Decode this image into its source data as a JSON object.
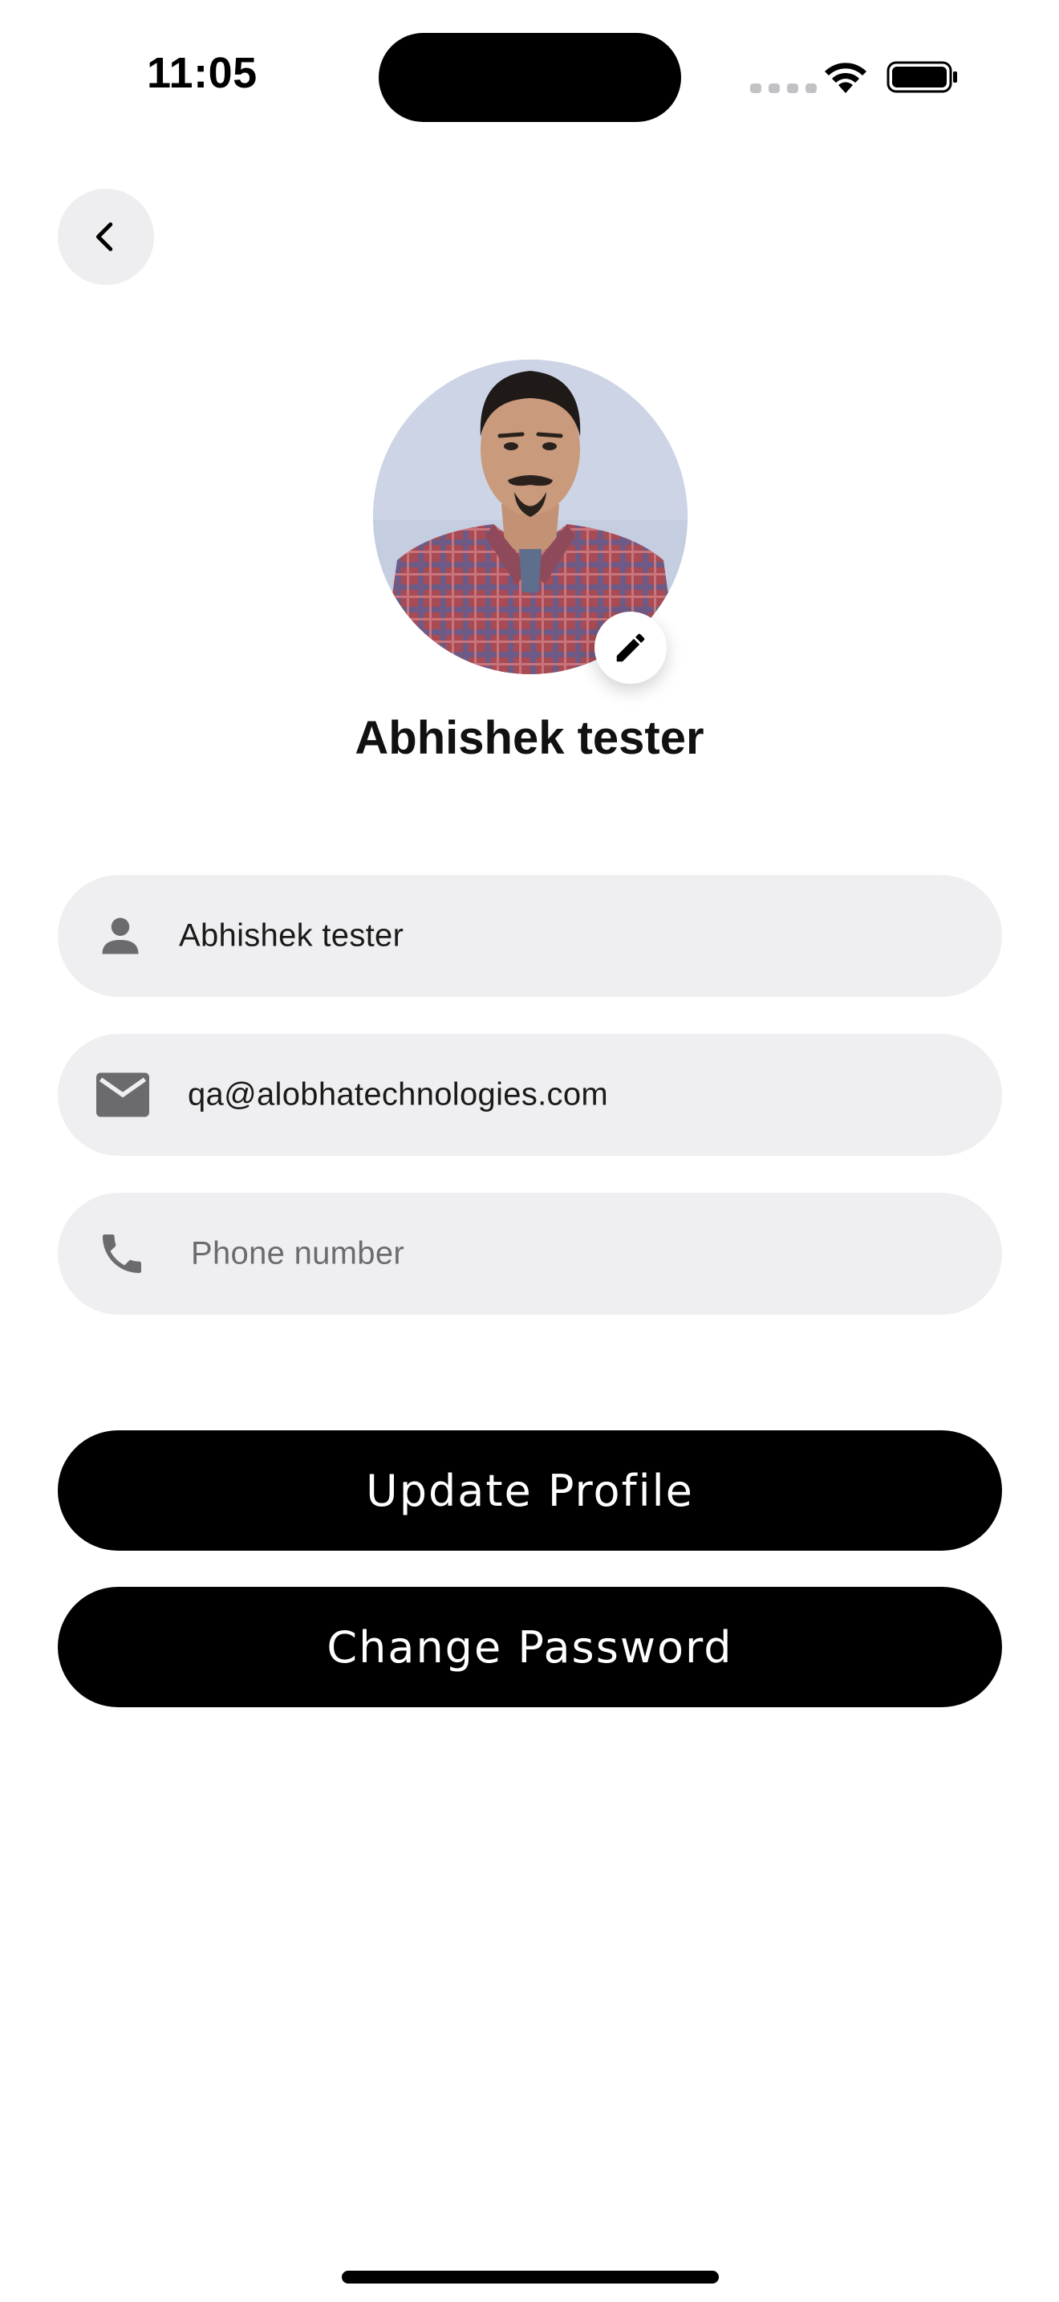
{
  "status_bar": {
    "time": "11:05"
  },
  "profile": {
    "display_name": "Abhishek tester"
  },
  "form": {
    "name": {
      "value": "Abhishek tester",
      "icon": "person-icon"
    },
    "email": {
      "value": "qa@alobhatechnologies.com",
      "icon": "mail-icon"
    },
    "phone": {
      "value": "",
      "placeholder": "Phone number",
      "icon": "phone-icon"
    }
  },
  "actions": {
    "update_profile_label": "Update Profile",
    "change_password_label": "Change Password"
  },
  "colors": {
    "background": "#ffffff",
    "field_background": "#efeff1",
    "button_background": "#000000",
    "button_text": "#ffffff",
    "icon_gray": "#6b6b6e"
  }
}
